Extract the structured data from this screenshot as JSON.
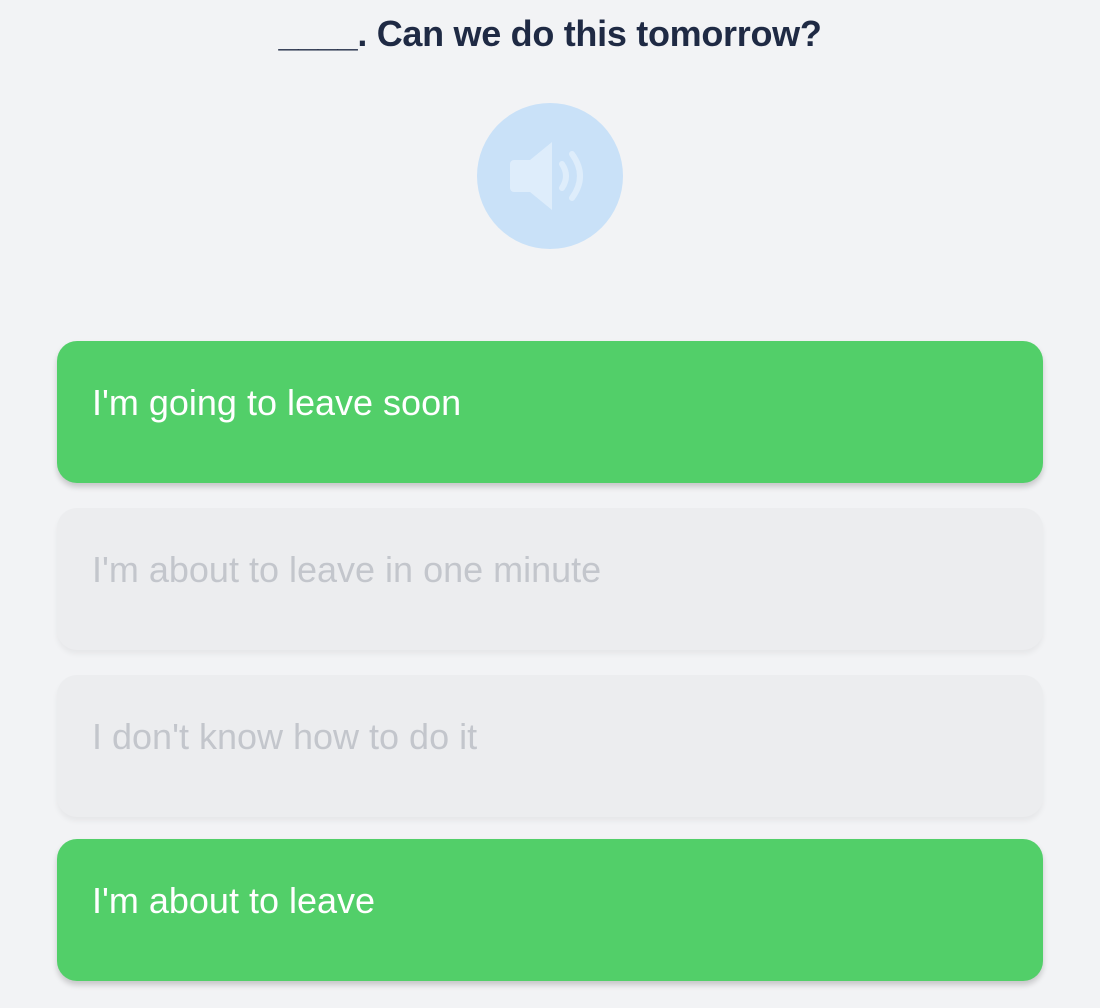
{
  "question": {
    "text": "____. Can we do this tomorrow?"
  },
  "audio": {
    "icon": "speaker-icon"
  },
  "options": [
    {
      "label": "I'm going to leave soon",
      "state": "correct"
    },
    {
      "label": "I'm about to leave in one minute",
      "state": "disabled"
    },
    {
      "label": "I don't know how to do it",
      "state": "disabled"
    },
    {
      "label": "I'm about to leave",
      "state": "correct"
    }
  ],
  "colors": {
    "background": "#f2f3f5",
    "question_text": "#1f2a44",
    "audio_circle": "#c9e1f8",
    "audio_icon": "#deedfb",
    "correct_bg": "#52cf69",
    "correct_text": "#ffffff",
    "disabled_bg": "#ecedef",
    "disabled_text": "#c3c6cc"
  }
}
